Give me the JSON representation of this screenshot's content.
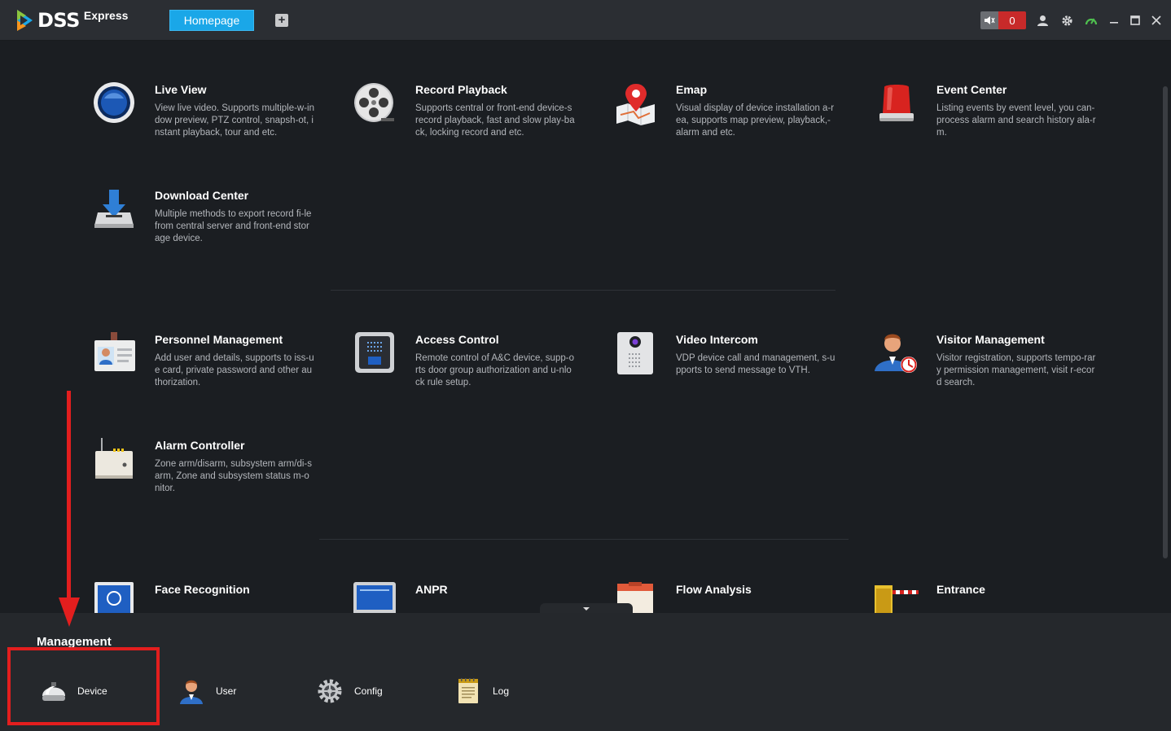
{
  "app": {
    "logo_text": "DSS",
    "logo_sub": "Express"
  },
  "tabs": {
    "home_label": "Homepage",
    "add_label": "+"
  },
  "toolbar": {
    "alarm_count": "0"
  },
  "modules": [
    {
      "title": "Live View",
      "desc": "View live video. Supports multiple-w-indow preview, PTZ control, snapsh-ot, instant playback, tour and etc.",
      "icon": "live-view-icon"
    },
    {
      "title": "Record Playback",
      "desc": "Supports central or front-end device-s record playback, fast and slow play-back, locking record and etc.",
      "icon": "film-reel-icon"
    },
    {
      "title": "Emap",
      "desc": "Visual display of device installation a-rea, supports map preview, playback,- alarm and etc.",
      "icon": "map-pin-icon"
    },
    {
      "title": "Event Center",
      "desc": "Listing events by event level, you can- process alarm and search history ala-rm.",
      "icon": "alarm-light-icon"
    },
    {
      "title": "Download Center",
      "desc": "Multiple methods to export record fi-le from central server and front-end storage device.",
      "icon": "download-icon"
    },
    {
      "title": "Personnel Management",
      "desc": "Add user and details, supports to iss-ue card, private password and other authorization.",
      "icon": "id-card-icon"
    },
    {
      "title": "Access Control",
      "desc": "Remote control of A&C device, supp-orts door group authorization and u-nlock rule setup.",
      "icon": "access-panel-icon"
    },
    {
      "title": "Video Intercom",
      "desc": "VDP device call and management, s-upports to send message to VTH.",
      "icon": "intercom-icon"
    },
    {
      "title": "Visitor Management",
      "desc": "Visitor registration, supports tempo-rary permission management, visit r-ecord search.",
      "icon": "visitor-icon"
    },
    {
      "title": "Alarm Controller",
      "desc": "Zone arm/disarm, subsystem arm/di-sarm, Zone and subsystem status m-onitor.",
      "icon": "alarm-controller-icon"
    },
    {
      "title": "Face Recognition",
      "desc": "",
      "icon": "face-recognition-icon"
    },
    {
      "title": "ANPR",
      "desc": "",
      "icon": "anpr-icon"
    },
    {
      "title": "Flow Analysis",
      "desc": "",
      "icon": "flow-analysis-icon"
    },
    {
      "title": "Entrance",
      "desc": "",
      "icon": "entrance-icon"
    }
  ],
  "management": {
    "title": "Management",
    "items": [
      {
        "label": "Device",
        "icon": "device-icon"
      },
      {
        "label": "User",
        "icon": "user-icon"
      },
      {
        "label": "Config",
        "icon": "gear-icon"
      },
      {
        "label": "Log",
        "icon": "log-icon"
      }
    ]
  },
  "colors": {
    "accent": "#1aa7e8",
    "alarm": "#c82a2a",
    "annotation": "#e31e1e"
  }
}
